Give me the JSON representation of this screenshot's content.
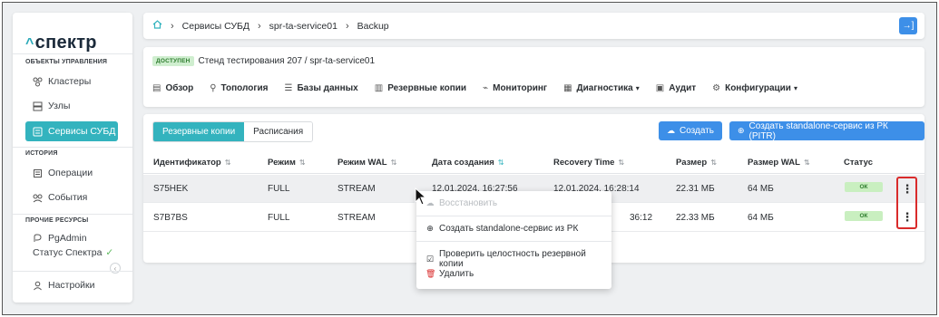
{
  "sidebar": {
    "logo": "спектр",
    "section_manage": "ОБЪЕКТЫ УПРАВЛЕНИЯ",
    "section_history": "ИСТОРИЯ",
    "section_other": "ПРОЧИЕ РЕСУРСЫ",
    "items": [
      {
        "label": "Кластеры"
      },
      {
        "label": "Узлы"
      },
      {
        "label": "Сервисы СУБД"
      },
      {
        "label": "Операции"
      },
      {
        "label": "События"
      },
      {
        "label": "PgAdmin"
      }
    ],
    "status_label": "Статус Спектра",
    "settings_label": "Настройки"
  },
  "breadcrumb": [
    "Сервисы СУБД",
    "spr-ta-service01",
    "Backup"
  ],
  "header": {
    "status_badge": "ДОСТУПЕН",
    "title": "Стенд тестирования 207 / spr-ta-service01",
    "tabs": [
      {
        "label": "Обзор",
        "icon": "doc-icon"
      },
      {
        "label": "Топология",
        "icon": "topology-icon"
      },
      {
        "label": "Базы данных",
        "icon": "database-icon"
      },
      {
        "label": "Резервные копии",
        "icon": "backup-icon"
      },
      {
        "label": "Мониторинг",
        "icon": "chart-icon"
      },
      {
        "label": "Диагностика",
        "icon": "diagnostics-icon",
        "dropdown": true
      },
      {
        "label": "Аудит",
        "icon": "audit-icon"
      },
      {
        "label": "Конфигурации",
        "icon": "gear-icon",
        "dropdown": true
      }
    ]
  },
  "toolbar": {
    "seg_backups": "Резервные копии",
    "seg_schedules": "Расписания",
    "create_label": "Создать",
    "create_standalone_label": "Создать standalone-сервис из РК (PITR)"
  },
  "table": {
    "columns": [
      "Идентификатор",
      "Режим",
      "Режим WAL",
      "Дата создания",
      "Recovery Time",
      "Размер",
      "Размер WAL",
      "Статус"
    ],
    "rows": [
      {
        "id": "S75HEK",
        "mode": "FULL",
        "wal_mode": "STREAM",
        "created": "12.01.2024, 16:27:56",
        "recovery": "12.01.2024, 16:28:14",
        "size": "22.31 МБ",
        "wal_size": "64 МБ",
        "status": "ОК"
      },
      {
        "id": "S7B7BS",
        "mode": "FULL",
        "wal_mode": "STREAM",
        "created": "",
        "recovery": "36:12",
        "size": "22.33 МБ",
        "wal_size": "64 МБ",
        "status": "ОК"
      }
    ]
  },
  "context_menu": {
    "restore": "Восстановить",
    "create_standalone": "Создать standalone-сервис из РК",
    "verify": "Проверить целостность резервной копии",
    "delete": "Удалить"
  },
  "colors": {
    "accent": "#33b3be",
    "primary": "#3d8fe8",
    "ok_bg": "#c9efc0",
    "highlight_border": "#d92b2b"
  }
}
